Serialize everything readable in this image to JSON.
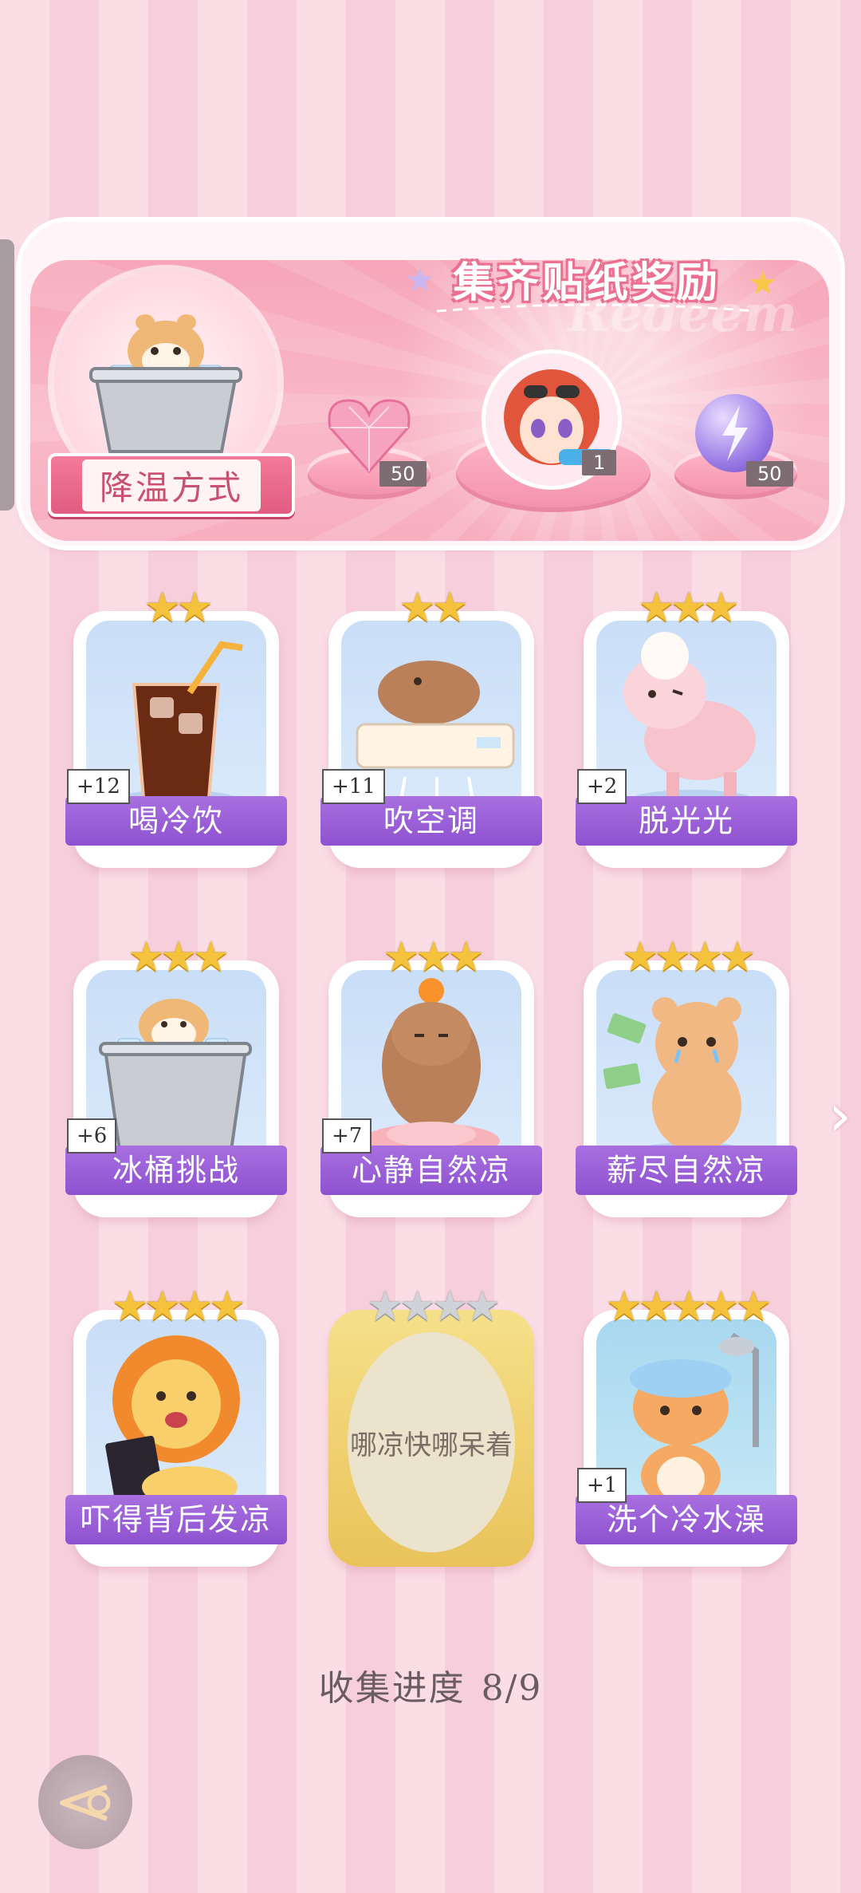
{
  "header": {
    "title": "集齐贴纸奖励",
    "watermark": "Redeem",
    "category_label": "降温方式",
    "rewards": [
      {
        "name": "pink-heart-gem",
        "count": "50"
      },
      {
        "name": "character-sticker",
        "count": "1"
      },
      {
        "name": "lightning-orb",
        "count": "50"
      }
    ]
  },
  "cards": [
    {
      "label": "喝冷饮",
      "stars": "★★",
      "count": "+12",
      "art": "iced-cola"
    },
    {
      "label": "吹空调",
      "stars": "★★",
      "count": "+11",
      "art": "capybara-ac"
    },
    {
      "label": "脱光光",
      "stars": "★★★",
      "count": "+2",
      "art": "shaved-sheep"
    },
    {
      "label": "冰桶挑战",
      "stars": "★★★",
      "count": "+6",
      "art": "hamster-ice-bucket"
    },
    {
      "label": "心静自然凉",
      "stars": "★★★",
      "count": "+7",
      "art": "capybara-lotus"
    },
    {
      "label": "薪尽自然凉",
      "stars": "★★★★",
      "count": "",
      "art": "crying-bear"
    },
    {
      "label": "吓得背后发凉",
      "stars": "★★★★",
      "count": "",
      "art": "scared-lion"
    },
    {
      "label": "哪凉快哪呆着",
      "stars": "★★★★",
      "count": "",
      "art": "locked"
    },
    {
      "label": "洗个冷水澡",
      "stars": "★★★★★",
      "count": "+1",
      "art": "cat-shower"
    }
  ],
  "progress": {
    "label": "收集进度",
    "value": "8/9"
  },
  "colors": {
    "accent_purple": "#9a5dd6",
    "panel_pink": "#f7aebf",
    "star_gold": "#f5c33b"
  }
}
